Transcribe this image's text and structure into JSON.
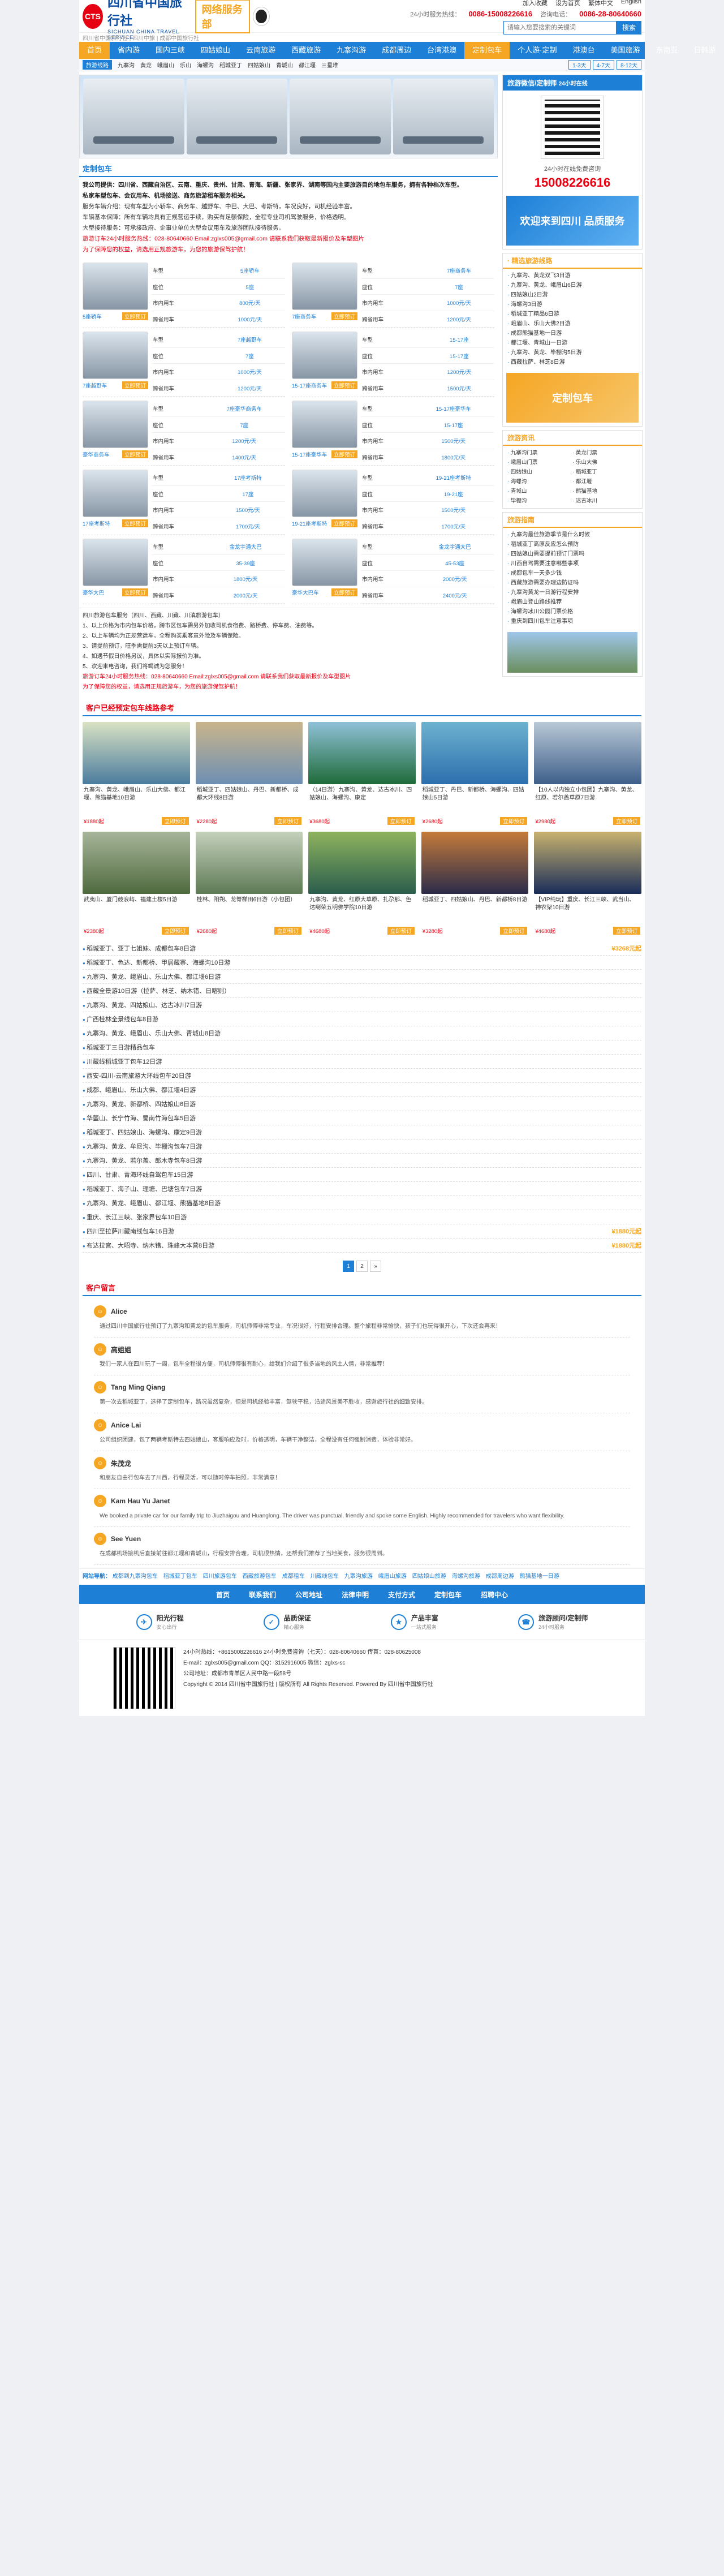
{
  "header": {
    "logo_mark": "CTS",
    "logo_cn": "四川省中国旅行社",
    "logo_en": "SICHUAN CHINA TRAVEL SERVICE",
    "brand2": "网络服务部",
    "top_links": [
      "加入收藏",
      "设为首页",
      "繁体中文",
      "English"
    ],
    "hotline_label": "24小时服务热线：",
    "hotline": "0086-15008226616",
    "landline_label": "咨询电话：",
    "landline": "0086-28-80640660",
    "search_placeholder": "请输入您要搜索的关键词",
    "search_button": "搜索",
    "strip": "四川省中国旅行社 | 四川中旅 | 成都中国旅行社"
  },
  "nav": [
    "首页",
    "省内游",
    "国内三峡",
    "四姑娘山",
    "云南旅游",
    "西藏旅游",
    "九寨沟游",
    "成都周边",
    "台湾港澳",
    "定制包车",
    "个人游·定制",
    "港澳台",
    "美国旅游",
    "东南亚",
    "日韩游",
    "关于我们"
  ],
  "subnav": {
    "tag": "旅游线路",
    "items": [
      "九寨沟",
      "黄龙",
      "峨眉山",
      "乐山",
      "海螺沟",
      "稻城亚丁",
      "四姑娘山",
      "青城山",
      "都江堰",
      "三星堆"
    ],
    "right": [
      "1-3天",
      "4-7天",
      "8-12天"
    ]
  },
  "main": {
    "title": "定制包车",
    "intro": [
      "我公司提供：四川省、西藏自治区、云南、重庆、贵州、甘肃、青海、新疆、张家界、湖南等国内主要旅游目的地包车服务，拥有各种档次车型。",
      "私家车型包车、会议用车、机场接送、商务旅游租车服务相关。",
      "服务车辆介绍：现有车型为小轿车、商务车、越野车、中巴、大巴、考斯特，车况良好，司机经验丰富。",
      "车辆基本保障：所有车辆均具有正规营运手续，购买有足额保险，全程专业司机驾驶服务，价格透明。",
      "大型接待服务：可承接政府、企事业单位大型会议用车及旅游团队接待服务。"
    ],
    "contact": "旅游订车24小时服务热线：028-80640660   Email:zglxs005@gmail.com   请联系我们获取最新报价及车型图片",
    "contact2": "为了保障您的权益，请选用正规旅游车，为您的旅游保驾护航！",
    "cars": [
      {
        "name": "5座轿车",
        "type": "5座轿车",
        "seats": "5座",
        "city": "800元/天",
        "long": "1000元/天"
      },
      {
        "name": "7座商务车",
        "type": "7座商务车",
        "seats": "7座",
        "city": "1000元/天",
        "long": "1200元/天"
      },
      {
        "name": "7座越野车",
        "type": "7座越野车",
        "seats": "7座",
        "city": "1000元/天",
        "long": "1200元/天"
      },
      {
        "name": "15-17座商务车",
        "type": "15-17座",
        "seats": "15-17座",
        "city": "1200元/天",
        "long": "1500元/天"
      },
      {
        "name": "豪华商务车",
        "type": "7座豪华商务车",
        "seats": "7座",
        "city": "1200元/天",
        "long": "1400元/天"
      },
      {
        "name": "15-17座豪华车",
        "type": "15-17座豪华车",
        "seats": "15-17座",
        "city": "1500元/天",
        "long": "1800元/天"
      },
      {
        "name": "17座考斯特",
        "type": "17座考斯特",
        "seats": "17座",
        "city": "1500元/天",
        "long": "1700元/天"
      },
      {
        "name": "19-21座考斯特",
        "type": "19-21座考斯特",
        "seats": "19-21座",
        "city": "1500元/天",
        "long": "1700元/天"
      },
      {
        "name": "豪华大巴",
        "type": "金龙宇通大巴",
        "seats": "35-39座",
        "city": "1800元/天",
        "long": "2000元/天"
      },
      {
        "name": "豪华大巴车",
        "type": "金龙宇通大巴",
        "seats": "45-53座",
        "city": "2000元/天",
        "long": "2400元/天"
      }
    ],
    "car_labels": {
      "type": "车型",
      "seats": "座位",
      "city": "市内用车",
      "long": "跨省用车",
      "book": "立即预订"
    },
    "notes": [
      "四川旅游包车服务（四川、西藏、川藏、川滇旅游包车）",
      "1、以上价格为市内包车价格，跨市区包车需另外加收司机食宿费、路桥费、停车费、油费等。",
      "2、以上车辆均为正规营运车，全程购买乘客意外险及车辆保险。",
      "3、请提前预订，旺季需提前3天以上预订车辆。",
      "4、如遇节假日价格另议，具体以实际报价为准。",
      "5、欢迎来电咨询，我们将竭诚为您服务！"
    ],
    "contact_foot": "旅游订车24小时服务热线：028-80640660   Email:zglxs005@gmail.com   请联系我们获取最新报价及车型图片",
    "contact_foot2": "为了保障您的权益，请选用正规旅游车，为您的旅游保驾护航！"
  },
  "tours_section": {
    "title": "客户已经预定包车线路参考",
    "tours": [
      {
        "title": "九寨沟、黄龙、峨眉山、乐山大佛、都江堰、熊猫基地10日游",
        "price": "¥1880起",
        "color1": "#4b7c9e",
        "color2": "#d9e2c3"
      },
      {
        "title": "稻城亚丁、四姑娘山、丹巴、新都桥、成都大环线8日游",
        "price": "¥2280起",
        "color1": "#6e8fb3",
        "color2": "#c9b58b"
      },
      {
        "title": "（14日游）九寨沟、黄龙、达古冰川、四姑娘山、海螺沟、康定",
        "price": "¥3680起",
        "color1": "#1f6b3a",
        "color2": "#8fc1d8"
      },
      {
        "title": "稻城亚丁、丹巴、新都桥、海螺沟、四姑娘山5日游",
        "price": "¥2680起",
        "color1": "#2c6fae",
        "color2": "#6db2cf"
      },
      {
        "title": "【10人以内独立小包团】九寨沟、黄龙、红原、若尔盖草原7日游",
        "price": "¥2980起",
        "color1": "#3e5f8a",
        "color2": "#b9c9d6"
      },
      {
        "title": "武夷山、厦门鼓浪屿、福建土楼5日游",
        "price": "¥2380起",
        "color1": "#4f6a3e",
        "color2": "#a7b59a"
      },
      {
        "title": "桂林、阳朔、龙脊梯田6日游（小包团）",
        "price": "¥2680起",
        "color1": "#5e7a55",
        "color2": "#c4d0bb"
      },
      {
        "title": "九寨沟、黄龙、红原大草原、扎尕那、色达喇荣五明佛学院10日游",
        "price": "¥4680起",
        "color1": "#2a5d4c",
        "color2": "#8eb35e"
      },
      {
        "title": "稻城亚丁、四姑娘山、丹巴、新都桥8日游",
        "price": "¥3280起",
        "color1": "#2b2b4a",
        "color2": "#c57b3a"
      },
      {
        "title": "【VIP纯玩】重庆、长江三峡、武当山、神农架10日游",
        "price": "¥4680起",
        "color1": "#1a2d5a",
        "color2": "#c8b26e"
      }
    ],
    "book": "立即预订",
    "list": [
      {
        "name": "稻城亚丁、亚丁七姐妹、成都包车8日游",
        "price": "¥3268元起"
      },
      {
        "name": "稻城亚丁、色达、新都桥、甲居藏寨、海螺沟10日游",
        "price": ""
      },
      {
        "name": "九寨沟、黄龙、峨眉山、乐山大佛、都江堰6日游",
        "price": ""
      },
      {
        "name": "西藏全景游10日游（拉萨、林芝、纳木错、日喀则）",
        "price": ""
      },
      {
        "name": "九寨沟、黄龙、四姑娘山、达古冰川7日游",
        "price": ""
      },
      {
        "name": "广西桂林全景线包车8日游",
        "price": ""
      },
      {
        "name": "九寨沟、黄龙、峨眉山、乐山大佛、青城山8日游",
        "price": ""
      },
      {
        "name": "稻城亚丁三日游精品包车",
        "price": ""
      },
      {
        "name": "川藏线稻城亚丁包车12日游",
        "price": ""
      },
      {
        "name": "西安-四川-云南旅游大环线包车20日游",
        "price": ""
      },
      {
        "name": "成都、峨眉山、乐山大佛、都江堰4日游",
        "price": ""
      },
      {
        "name": "九寨沟、黄龙、新都桥、四姑娘山6日游",
        "price": ""
      },
      {
        "name": "华蓥山、长宁竹海、蜀南竹海包车5日游",
        "price": ""
      },
      {
        "name": "稻城亚丁、四姑娘山、海螺沟、康定9日游",
        "price": ""
      },
      {
        "name": "九寨沟、黄龙、牟尼沟、毕棚沟包车7日游",
        "price": ""
      },
      {
        "name": "九寨沟、黄龙、若尔盖、郎木寺包车8日游",
        "price": ""
      },
      {
        "name": "四川、甘肃、青海环线自驾包车15日游",
        "price": ""
      },
      {
        "name": "稻城亚丁、海子山、理塘、巴塘包车7日游",
        "price": ""
      },
      {
        "name": "九寨沟、黄龙、峨眉山、都江堰、熊猫基地8日游",
        "price": ""
      },
      {
        "name": "重庆、长江三峡、张家界包车10日游",
        "price": ""
      },
      {
        "name": "四川至拉萨川藏南线包车16日游",
        "price": "¥1880元起"
      },
      {
        "name": "布达拉宫、大昭寺、纳木错、珠峰大本营8日游",
        "price": "¥1880元起"
      }
    ],
    "pages": [
      "1",
      "2",
      "»"
    ]
  },
  "reviews_section": {
    "title": "客户留言",
    "reviews": [
      {
        "name": "Alice",
        "text": "通过四川中国旅行社预订了九寨沟和黄龙的包车服务，司机师傅非常专业，车况很好，行程安排合理。整个旅程非常愉快，孩子们也玩得很开心，下次还会再来！"
      },
      {
        "name": "高姐姐",
        "text": "我们一家人在四川玩了一周，包车全程很方便，司机师傅很有耐心，给我们介绍了很多当地的风土人情，非常推荐！"
      },
      {
        "name": "Tang Ming Qiang",
        "text": "第一次去稻城亚丁，选择了定制包车，路况虽然复杂，但是司机经验丰富，驾驶平稳，沿途风景美不胜收，感谢旅行社的细致安排。"
      },
      {
        "name": "Anice Lai",
        "text": "公司组织团建，包了两辆考斯特去四姑娘山，客服响应及时，价格透明，车辆干净整洁，全程没有任何强制消费，体验非常好。"
      },
      {
        "name": "朱茂龙",
        "text": "和朋友自由行包车去了川西，行程灵活，可以随时停车拍照，非常满意！"
      },
      {
        "name": "Kam Hau Yu Janet",
        "text": "We booked a private car for our family trip to Jiuzhaigou and Huanglong. The driver was punctual, friendly and spoke some English. Highly recommended for travelers who want flexibility."
      },
      {
        "name": "See Yuen",
        "text": "在成都机场接机后直接前往都江堰和青城山，行程安排合理，司机很热情，还帮我们推荐了当地美食，服务很周到。"
      }
    ]
  },
  "links": {
    "label": "网站导航：",
    "items": [
      "成都到九寨沟包车",
      "稻城亚丁包车",
      "四川旅游包车",
      "西藏旅游包车",
      "成都租车",
      "川藏线包车",
      "九寨沟旅游",
      "峨眉山旅游",
      "四姑娘山旅游",
      "海螺沟旅游",
      "成都周边游",
      "熊猫基地一日游"
    ]
  },
  "side": {
    "wechat_title": "旅游微信/定制师",
    "wechat_sub": "24小时在线",
    "tel_label": "24小时在线免费咨询",
    "tel": "15008226616",
    "ad1": "欢迎来到四川",
    "ad1b": "品质服务",
    "lines_title": "· 精选旅游线路",
    "lines": [
      "九寨沟、黄龙双飞3日游",
      "九寨沟、黄龙、峨眉山6日游",
      "四姑娘山2日游",
      "海螺沟3日游",
      "稻城亚丁精品6日游",
      "峨眉山、乐山大佛2日游",
      "成都熊猫基地一日游",
      "都江堰、青城山一日游",
      "九寨沟、黄龙、毕棚沟5日游",
      "西藏拉萨、林芝8日游"
    ],
    "ad2": "定制包车",
    "news_title": "旅游资讯",
    "news": [
      "九寨沟门票",
      "黄龙门票",
      "峨眉山门票",
      "乐山大佛",
      "四姑娘山",
      "稻城亚丁",
      "海螺沟",
      "都江堰",
      "青城山",
      "熊猫基地",
      "毕棚沟",
      "达古冰川"
    ],
    "faq_title": "旅游指南",
    "faq": [
      "九寨沟最佳旅游季节是什么时候",
      "稻城亚丁高原反应怎么预防",
      "四姑娘山需要提前预订门票吗",
      "川西自驾需要注意哪些事项",
      "成都包车一天多少钱",
      "西藏旅游需要办理边防证吗",
      "九寨沟黄龙一日游行程安排",
      "峨眉山登山路线推荐",
      "海螺沟冰川公园门票价格",
      "重庆到四川包车注意事项"
    ]
  },
  "footer": {
    "nav": [
      "首页",
      "联系我们",
      "公司地址",
      "法律申明",
      "支付方式",
      "定制包车",
      "招聘中心"
    ],
    "badges": [
      {
        "icon": "✈",
        "t": "阳光行程",
        "s": "安心出行"
      },
      {
        "icon": "✓",
        "t": "品质保证",
        "s": "精心服务"
      },
      {
        "icon": "★",
        "t": "产品丰富",
        "s": "一站式服务"
      },
      {
        "icon": "☎",
        "t": "旅游顾问/定制师",
        "s": "24小时服务"
      }
    ],
    "info": [
      "24小时热线：+8615008226616   24小时免费咨询（七天）：028-80640660   传真：028-80625008",
      "E-mail：zglxs005@gmail.com   QQ：3152916005   微信：zglxs-sc",
      "公司地址：成都市青羊区人民中路一段58号",
      "Copyright © 2014 四川省中国旅行社 | 版权所有 All Rights Reserved. Powered By 四川省中国旅行社"
    ]
  }
}
